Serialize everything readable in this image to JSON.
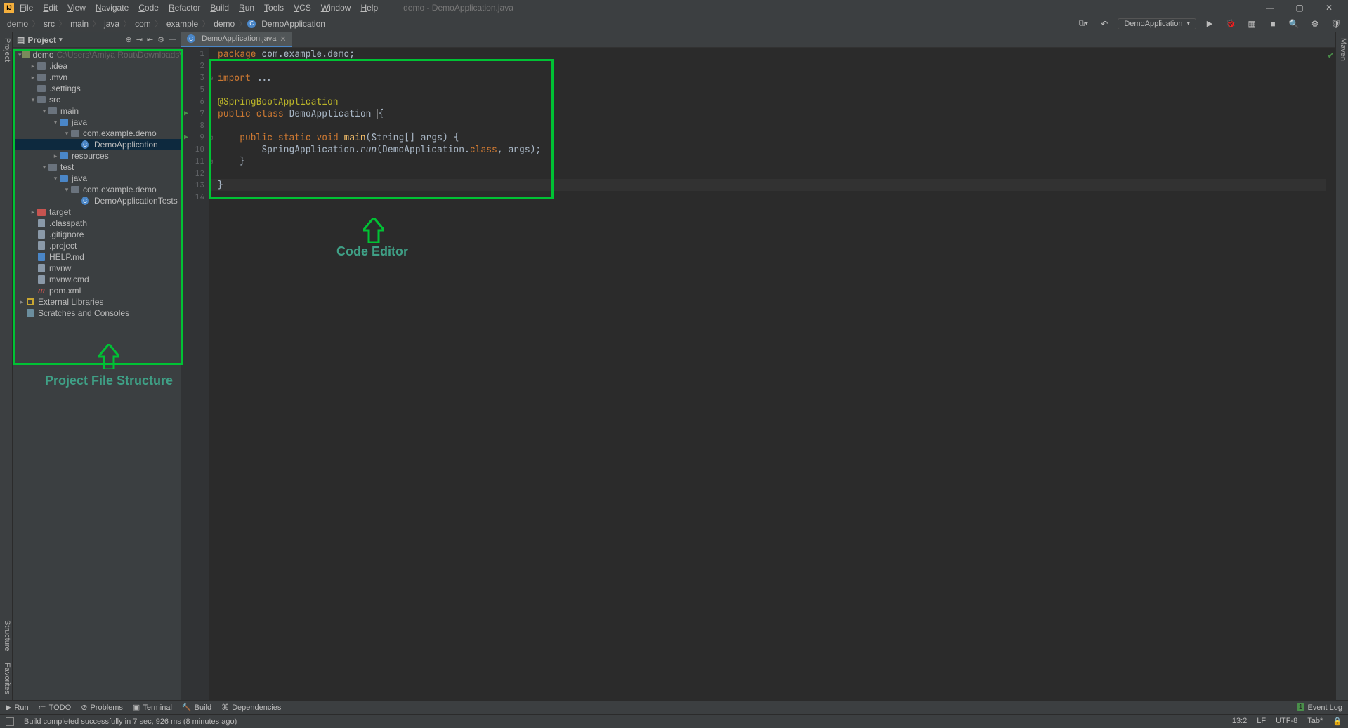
{
  "menubar": {
    "items": [
      "File",
      "Edit",
      "View",
      "Navigate",
      "Code",
      "Refactor",
      "Build",
      "Run",
      "Tools",
      "VCS",
      "Window",
      "Help"
    ],
    "title": "demo - DemoApplication.java"
  },
  "breadcrumb": [
    "demo",
    "src",
    "main",
    "java",
    "com",
    "example",
    "demo",
    "DemoApplication"
  ],
  "run_config": "DemoApplication",
  "project_panel": {
    "title": "Project",
    "root": {
      "name": "demo",
      "hint": "C:\\Users\\Amiya Rout\\Downloads\\demo"
    }
  },
  "tree": [
    {
      "depth": 0,
      "arrow": "▾",
      "icon": "module",
      "label": "demo",
      "hint": "C:\\Users\\Amiya Rout\\Downloads\\demo"
    },
    {
      "depth": 1,
      "arrow": "▸",
      "icon": "folder",
      "label": ".idea"
    },
    {
      "depth": 1,
      "arrow": "▸",
      "icon": "folder",
      "label": ".mvn"
    },
    {
      "depth": 1,
      "arrow": "",
      "icon": "folder",
      "label": ".settings"
    },
    {
      "depth": 1,
      "arrow": "▾",
      "icon": "folder",
      "label": "src"
    },
    {
      "depth": 2,
      "arrow": "▾",
      "icon": "folder",
      "label": "main"
    },
    {
      "depth": 3,
      "arrow": "▾",
      "icon": "src",
      "label": "java"
    },
    {
      "depth": 4,
      "arrow": "▾",
      "icon": "folder",
      "label": "com.example.demo"
    },
    {
      "depth": 5,
      "arrow": "",
      "icon": "class",
      "label": "DemoApplication",
      "selected": true
    },
    {
      "depth": 3,
      "arrow": "▸",
      "icon": "src",
      "label": "resources"
    },
    {
      "depth": 2,
      "arrow": "▾",
      "icon": "folder",
      "label": "test"
    },
    {
      "depth": 3,
      "arrow": "▾",
      "icon": "src",
      "label": "java"
    },
    {
      "depth": 4,
      "arrow": "▾",
      "icon": "folder",
      "label": "com.example.demo"
    },
    {
      "depth": 5,
      "arrow": "",
      "icon": "class",
      "label": "DemoApplicationTests"
    },
    {
      "depth": 1,
      "arrow": "▸",
      "icon": "target",
      "label": "target"
    },
    {
      "depth": 1,
      "arrow": "",
      "icon": "file",
      "label": ".classpath"
    },
    {
      "depth": 1,
      "arrow": "",
      "icon": "file",
      "label": ".gitignore"
    },
    {
      "depth": 1,
      "arrow": "",
      "icon": "file",
      "label": ".project"
    },
    {
      "depth": 1,
      "arrow": "",
      "icon": "md",
      "label": "HELP.md"
    },
    {
      "depth": 1,
      "arrow": "",
      "icon": "file",
      "label": "mvnw"
    },
    {
      "depth": 1,
      "arrow": "",
      "icon": "file",
      "label": "mvnw.cmd"
    },
    {
      "depth": 1,
      "arrow": "",
      "icon": "m",
      "label": "pom.xml"
    },
    {
      "depth": 0,
      "arrow": "▸",
      "icon": "lib",
      "label": "External Libraries"
    },
    {
      "depth": 0,
      "arrow": "",
      "icon": "scratch",
      "label": "Scratches and Consoles"
    }
  ],
  "editor": {
    "tab": "DemoApplication.java",
    "lines": {
      "l1p": "package",
      "l1t": " com.example.demo;",
      "l3p": "import",
      "l3t": " ...",
      "l6": "@SpringBootApplication",
      "l7a": "public",
      "l7b": "class",
      "l7c": "DemoApplication ",
      "l7d": "{",
      "l9a": "public",
      "l9b": "static",
      "l9c": "void",
      "l9d": "main",
      "l9e": "(String[] args) {",
      "l10a": "SpringApplication.",
      "l10b": "run",
      "l10c": "(DemoApplication.",
      "l10d": "class",
      "l10e": ", args);",
      "l11": "}",
      "l13": "}"
    }
  },
  "annotations": {
    "project_label": "Project File Structure",
    "editor_label": "Code Editor"
  },
  "gutter_labels": {
    "project": "Project",
    "structure": "Structure",
    "favorites": "Favorites",
    "maven": "Maven"
  },
  "bottom_tools": {
    "run": "Run",
    "todo": "TODO",
    "problems": "Problems",
    "terminal": "Terminal",
    "build": "Build",
    "dependencies": "Dependencies",
    "eventlog": "Event Log"
  },
  "status": {
    "msg": "Build completed successfully in 7 sec, 926 ms (8 minutes ago)",
    "pos": "13:2",
    "lf": "LF",
    "enc": "UTF-8",
    "indent": "Tab*"
  }
}
